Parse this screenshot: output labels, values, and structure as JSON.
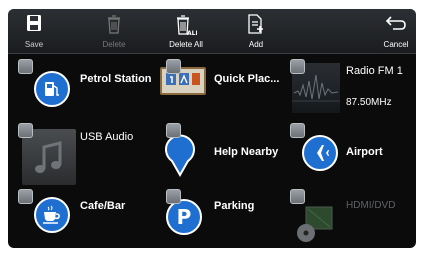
{
  "toolbar": {
    "save_label": "Save",
    "delete_label": "Delete",
    "delete_all_label": "Delete All",
    "add_label": "Add",
    "cancel_label": "Cancel"
  },
  "shortcuts": {
    "petrol_station": "Petrol Station",
    "quick_place": "Quick Plac...",
    "radio": "Radio FM 1",
    "radio_freq": "87.50MHz",
    "usb_audio": "USB Audio",
    "help_nearby": "Help Nearby",
    "airport": "Airport",
    "cafe_bar": "Cafe/Bar",
    "parking": "Parking",
    "parking_letter": "P",
    "hdmi_dvd": "HDMI/DVD"
  },
  "colors": {
    "accent_blue": "#1f6fd0",
    "background": "#0b0b0b",
    "toolbar": "#2c2f33"
  },
  "icons": {
    "save": "floppy-disk-icon",
    "delete": "trash-icon",
    "delete_all": "trash-all-icon",
    "add": "document-add-icon",
    "cancel": "return-arrow-icon"
  }
}
